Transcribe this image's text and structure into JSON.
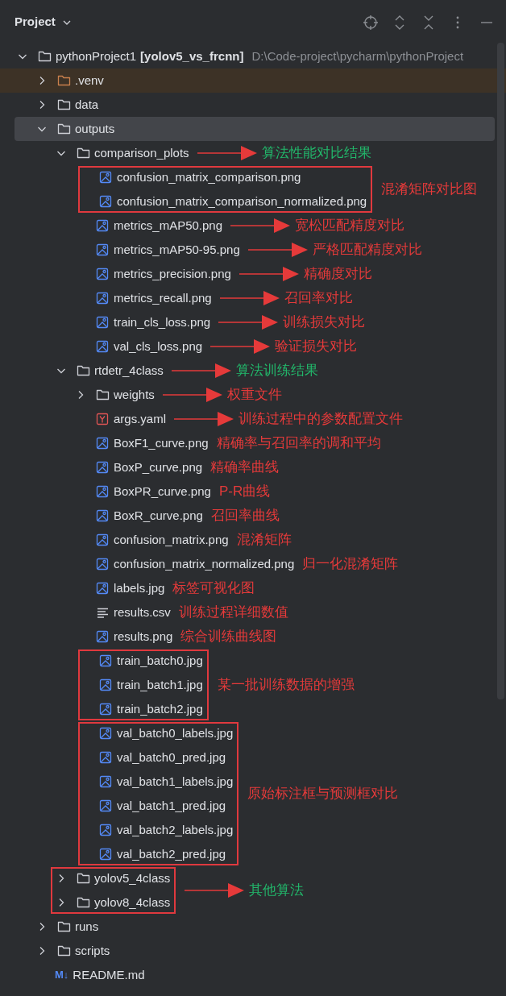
{
  "panel": {
    "title": "Project"
  },
  "tree": [
    {
      "name": "pythonProject1",
      "branch": "[yolov5_vs_frcnn]",
      "path": "D:\\Code-project\\pycharm\\pythonProject",
      "kind": "folder",
      "expanded": true,
      "selected": false,
      "children": [
        {
          "name": ".venv",
          "kind": "excluded_folder",
          "expanded": false,
          "selected": false
        },
        {
          "name": "data",
          "kind": "folder",
          "expanded": false,
          "selected": false
        },
        {
          "name": "outputs",
          "kind": "folder",
          "expanded": true,
          "selected": true,
          "children": [
            {
              "name": "comparison_plots",
              "kind": "folder",
              "expanded": true,
              "selected": false,
              "note": {
                "text": "算法性能对比结果",
                "color": "#22b86b",
                "arrow": true
              },
              "children": [
                {
                  "kind": "group",
                  "note": {
                    "text": "混淆矩阵对比图",
                    "color": "#e53a3a",
                    "arrow": false
                  },
                  "children": [
                    {
                      "name": "confusion_matrix_comparison.png",
                      "kind": "image",
                      "selected": false
                    },
                    {
                      "name": "confusion_matrix_comparison_normalized.png",
                      "kind": "image",
                      "selected": false
                    }
                  ]
                },
                {
                  "name": "metrics_mAP50.png",
                  "kind": "image",
                  "selected": false,
                  "note": {
                    "text": "宽松匹配精度对比",
                    "color": "#e53a3a",
                    "arrow": true
                  }
                },
                {
                  "name": "metrics_mAP50-95.png",
                  "kind": "image",
                  "selected": false,
                  "note": {
                    "text": "严格匹配精度对比",
                    "color": "#e53a3a",
                    "arrow": true
                  }
                },
                {
                  "name": "metrics_precision.png",
                  "kind": "image",
                  "selected": false,
                  "note": {
                    "text": "精确度对比",
                    "color": "#e53a3a",
                    "arrow": true
                  }
                },
                {
                  "name": "metrics_recall.png",
                  "kind": "image",
                  "selected": false,
                  "note": {
                    "text": "召回率对比",
                    "color": "#e53a3a",
                    "arrow": true
                  }
                },
                {
                  "name": "train_cls_loss.png",
                  "kind": "image",
                  "selected": false,
                  "note": {
                    "text": "训练损失对比",
                    "color": "#e53a3a",
                    "arrow": true
                  }
                },
                {
                  "name": "val_cls_loss.png",
                  "kind": "image",
                  "selected": false,
                  "note": {
                    "text": "验证损失对比",
                    "color": "#e53a3a",
                    "arrow": true
                  }
                }
              ]
            },
            {
              "name": "rtdetr_4class",
              "kind": "folder",
              "expanded": true,
              "selected": false,
              "note": {
                "text": "算法训练结果",
                "color": "#22b86b",
                "arrow": true
              },
              "children": [
                {
                  "name": "weights",
                  "kind": "folder",
                  "expanded": false,
                  "selected": false,
                  "note": {
                    "text": "权重文件",
                    "color": "#e53a3a",
                    "arrow": true
                  }
                },
                {
                  "name": "args.yaml",
                  "kind": "yaml",
                  "selected": false,
                  "note": {
                    "text": "训练过程中的参数配置文件",
                    "color": "#e53a3a",
                    "arrow": true
                  }
                },
                {
                  "name": "BoxF1_curve.png",
                  "kind": "image",
                  "selected": false,
                  "note": {
                    "text": "精确率与召回率的调和平均",
                    "color": "#e53a3a",
                    "arrow": false
                  }
                },
                {
                  "name": "BoxP_curve.png",
                  "kind": "image",
                  "selected": false,
                  "note": {
                    "text": "精确率曲线",
                    "color": "#e53a3a",
                    "arrow": false
                  }
                },
                {
                  "name": "BoxPR_curve.png",
                  "kind": "image",
                  "selected": false,
                  "note": {
                    "text": "P-R曲线",
                    "color": "#e53a3a",
                    "arrow": false
                  }
                },
                {
                  "name": "BoxR_curve.png",
                  "kind": "image",
                  "selected": false,
                  "note": {
                    "text": "召回率曲线",
                    "color": "#e53a3a",
                    "arrow": false
                  }
                },
                {
                  "name": "confusion_matrix.png",
                  "kind": "image",
                  "selected": false,
                  "note": {
                    "text": "混淆矩阵",
                    "color": "#e53a3a",
                    "arrow": false
                  }
                },
                {
                  "name": "confusion_matrix_normalized.png",
                  "kind": "image",
                  "selected": false,
                  "note": {
                    "text": "归一化混淆矩阵",
                    "color": "#e53a3a",
                    "arrow": false
                  }
                },
                {
                  "name": "labels.jpg",
                  "kind": "image",
                  "selected": false,
                  "note": {
                    "text": "标签可视化图",
                    "color": "#e53a3a",
                    "arrow": false
                  }
                },
                {
                  "name": "results.csv",
                  "kind": "text",
                  "selected": false,
                  "note": {
                    "text": "训练过程详细数值",
                    "color": "#e53a3a",
                    "arrow": false
                  }
                },
                {
                  "name": "results.png",
                  "kind": "image",
                  "selected": false,
                  "note": {
                    "text": "综合训练曲线图",
                    "color": "#e53a3a",
                    "arrow": false
                  }
                },
                {
                  "kind": "group",
                  "note": {
                    "text": "某一批训练数据的增强",
                    "color": "#e53a3a",
                    "arrow": false
                  },
                  "children": [
                    {
                      "name": "train_batch0.jpg",
                      "kind": "image",
                      "selected": false
                    },
                    {
                      "name": "train_batch1.jpg",
                      "kind": "image",
                      "selected": false
                    },
                    {
                      "name": "train_batch2.jpg",
                      "kind": "image",
                      "selected": false
                    }
                  ]
                },
                {
                  "kind": "group",
                  "note": {
                    "text": "原始标注框与预测框对比",
                    "color": "#e53a3a",
                    "arrow": false
                  },
                  "children": [
                    {
                      "name": "val_batch0_labels.jpg",
                      "kind": "image",
                      "selected": false
                    },
                    {
                      "name": "val_batch0_pred.jpg",
                      "kind": "image",
                      "selected": false
                    },
                    {
                      "name": "val_batch1_labels.jpg",
                      "kind": "image",
                      "selected": false
                    },
                    {
                      "name": "val_batch1_pred.jpg",
                      "kind": "image",
                      "selected": false
                    },
                    {
                      "name": "val_batch2_labels.jpg",
                      "kind": "image",
                      "selected": false
                    },
                    {
                      "name": "val_batch2_pred.jpg",
                      "kind": "image",
                      "selected": false
                    }
                  ]
                }
              ]
            },
            {
              "kind": "group",
              "note": {
                "text": "其他算法",
                "color": "#22b86b",
                "arrow": true
              },
              "children": [
                {
                  "name": "yolov5_4class",
                  "kind": "folder",
                  "expanded": false,
                  "selected": false
                },
                {
                  "name": "yolov8_4class",
                  "kind": "folder",
                  "expanded": false,
                  "selected": false
                }
              ]
            }
          ]
        },
        {
          "name": "runs",
          "kind": "folder",
          "expanded": false,
          "selected": false
        },
        {
          "name": "scripts",
          "kind": "folder",
          "expanded": false,
          "selected": false
        },
        {
          "name": "README.md",
          "kind": "markdown",
          "icon_text": "M↓",
          "selected": false
        }
      ]
    }
  ]
}
